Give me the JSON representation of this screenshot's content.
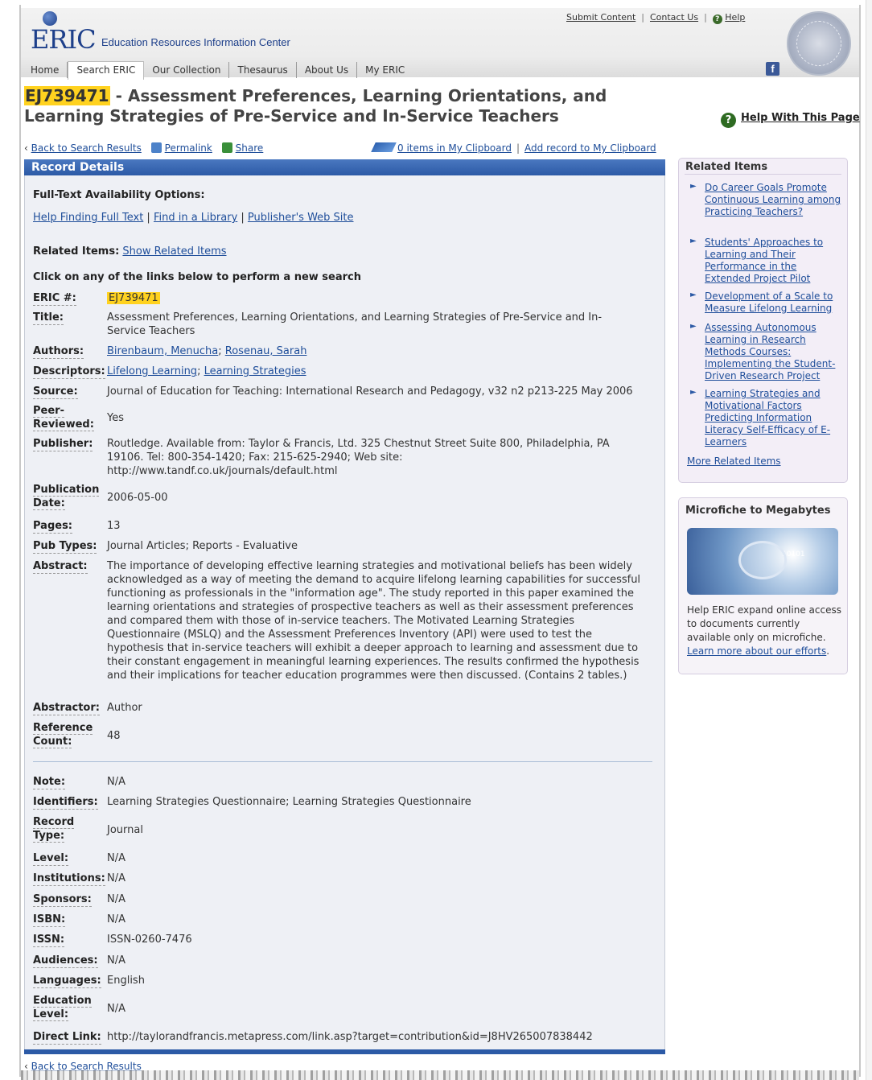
{
  "header": {
    "logo": "ERIC",
    "tagline": "Education Resources Information Center",
    "top_links": [
      "Submit Content",
      "Contact Us",
      "Help"
    ],
    "nav_tabs": [
      "Home",
      "Search ERIC",
      "Our Collection",
      "Thesaurus",
      "About Us",
      "My ERIC"
    ],
    "active_tab": "Search ERIC",
    "facebook_label": "f"
  },
  "title": {
    "id": "EJ739471",
    "text_line1": " - Assessment Preferences, Learning Orientations, and",
    "text_line2": "Learning Strategies of Pre-Service and In-Service Teachers"
  },
  "help_page_label": "Help With This Page",
  "utility": {
    "back": "Back to Search Results",
    "permalink": "Permalink",
    "share": "Share",
    "clipboard": "0 items in My Clipboard",
    "add_record": "Add record to My Clipboard"
  },
  "record": {
    "panel_title": "Record Details",
    "fulltext_heading": "Full-Text Availability Options:",
    "fulltext_links": [
      "Help Finding Full Text",
      "Find in a Library",
      "Publisher's Web Site"
    ],
    "related_label": "Related Items:",
    "related_link": "Show Related Items",
    "click_hint": "Click on any of the links below to perform a new search",
    "eric_label": "ERIC #:",
    "eric_value": "EJ739471",
    "title_label": "Title:",
    "title_value": "Assessment Preferences, Learning Orientations, and Learning Strategies of Pre-Service and In-Service Teachers",
    "authors_label": "Authors:",
    "authors": [
      "Birenbaum, Menucha",
      "Rosenau, Sarah"
    ],
    "descriptors_label": "Descriptors:",
    "descriptors": [
      "Lifelong Learning",
      "Learning Strategies"
    ],
    "source_label": "Source:",
    "source_value": "Journal of Education for Teaching: International Research and Pedagogy, v32 n2 p213-225 May 2006",
    "peer_label_1": "Peer-",
    "peer_label_2": "Reviewed:",
    "peer_value": "Yes",
    "publisher_label": "Publisher:",
    "publisher_value": "Routledge. Available from: Taylor & Francis, Ltd. 325 Chestnut Street Suite 800, Philadelphia, PA 19106. Tel: 800-354-1420; Fax: 215-625-2940; Web site: http://www.tandf.co.uk/journals/default.html",
    "pubdate_label_1": "Publication",
    "pubdate_label_2": "Date:",
    "pubdate_value": "2006-05-00",
    "pages_label": "Pages:",
    "pages_value": "13",
    "pubtypes_label": "Pub Types:",
    "pubtypes_value": "Journal Articles; Reports - Evaluative",
    "abstract_label": "Abstract:",
    "abstract_value": "The importance of developing effective learning strategies and motivational beliefs has been widely acknowledged as a way of meeting the demand to acquire lifelong learning capabilities for successful functioning as professionals in the \"information age\". The study reported in this paper examined the learning orientations and strategies of prospective teachers as well as their assessment preferences and compared them with those of in-service teachers. The Motivated Learning Strategies Questionnaire (MSLQ) and the Assessment Preferences Inventory (API) were used to test the hypothesis that in-service teachers will exhibit a deeper approach to learning and assessment due to their constant engagement in meaningful learning experiences. The results confirmed the hypothesis and their implications for teacher education programmes were then discussed. (Contains 2 tables.)",
    "abstractor_label": "Abstractor:",
    "abstractor_value": "Author",
    "refcount_label_1": "Reference",
    "refcount_label_2": "Count:",
    "refcount_value": "48",
    "note_label": "Note:",
    "note_value": "N/A",
    "identifiers_label": "Identifiers:",
    "identifiers_value": "Learning Strategies Questionnaire; Learning Strategies Questionnaire",
    "rectype_label_1": "Record",
    "rectype_label_2": "Type:",
    "rectype_value": "Journal",
    "level_label": "Level:",
    "level_value": "N/A",
    "institutions_label": "Institutions:",
    "institutions_value": "N/A",
    "sponsors_label": "Sponsors:",
    "sponsors_value": "N/A",
    "isbn_label": "ISBN:",
    "isbn_value": "N/A",
    "issn_label": "ISSN:",
    "issn_value": "ISSN-0260-7476",
    "audiences_label": "Audiences:",
    "audiences_value": "N/A",
    "languages_label": "Languages:",
    "languages_value": "English",
    "edlevel_label_1": "Education",
    "edlevel_label_2": "Level:",
    "edlevel_value": "N/A",
    "directlink_label": "Direct Link:",
    "directlink_value": "http://taylorandfrancis.metapress.com/link.asp?target=contribution&id=J8HV265007838442"
  },
  "sidebar": {
    "related_title": "Related Items",
    "related_items": [
      "Do Career Goals Promote Continuous Learning among Practicing Teachers?",
      "Students' Approaches to Learning and Their Performance in the Extended Project Pilot",
      "Development of a Scale to Measure Lifelong Learning",
      "Assessing Autonomous Learning in Research Methods Courses: Implementing the Student-Driven Research Project",
      "Learning Strategies and Motivational Factors Predicting Information Literacy Self-Efficacy of E-Learners"
    ],
    "more_related": "More Related Items",
    "micro_title": "Microfiche to Megabytes",
    "micro_text": "Help ERIC expand online access to documents currently available only on microfiche.",
    "micro_link": "Learn more about our efforts",
    "micro_image_text": "10101"
  },
  "bottom_back": "Back to Search Results",
  "colors": {
    "accent": "#2c5aa6",
    "highlight": "#ffd21f",
    "panel_bg": "#eef0f5",
    "sidebar_bg": "#f3eef7"
  }
}
